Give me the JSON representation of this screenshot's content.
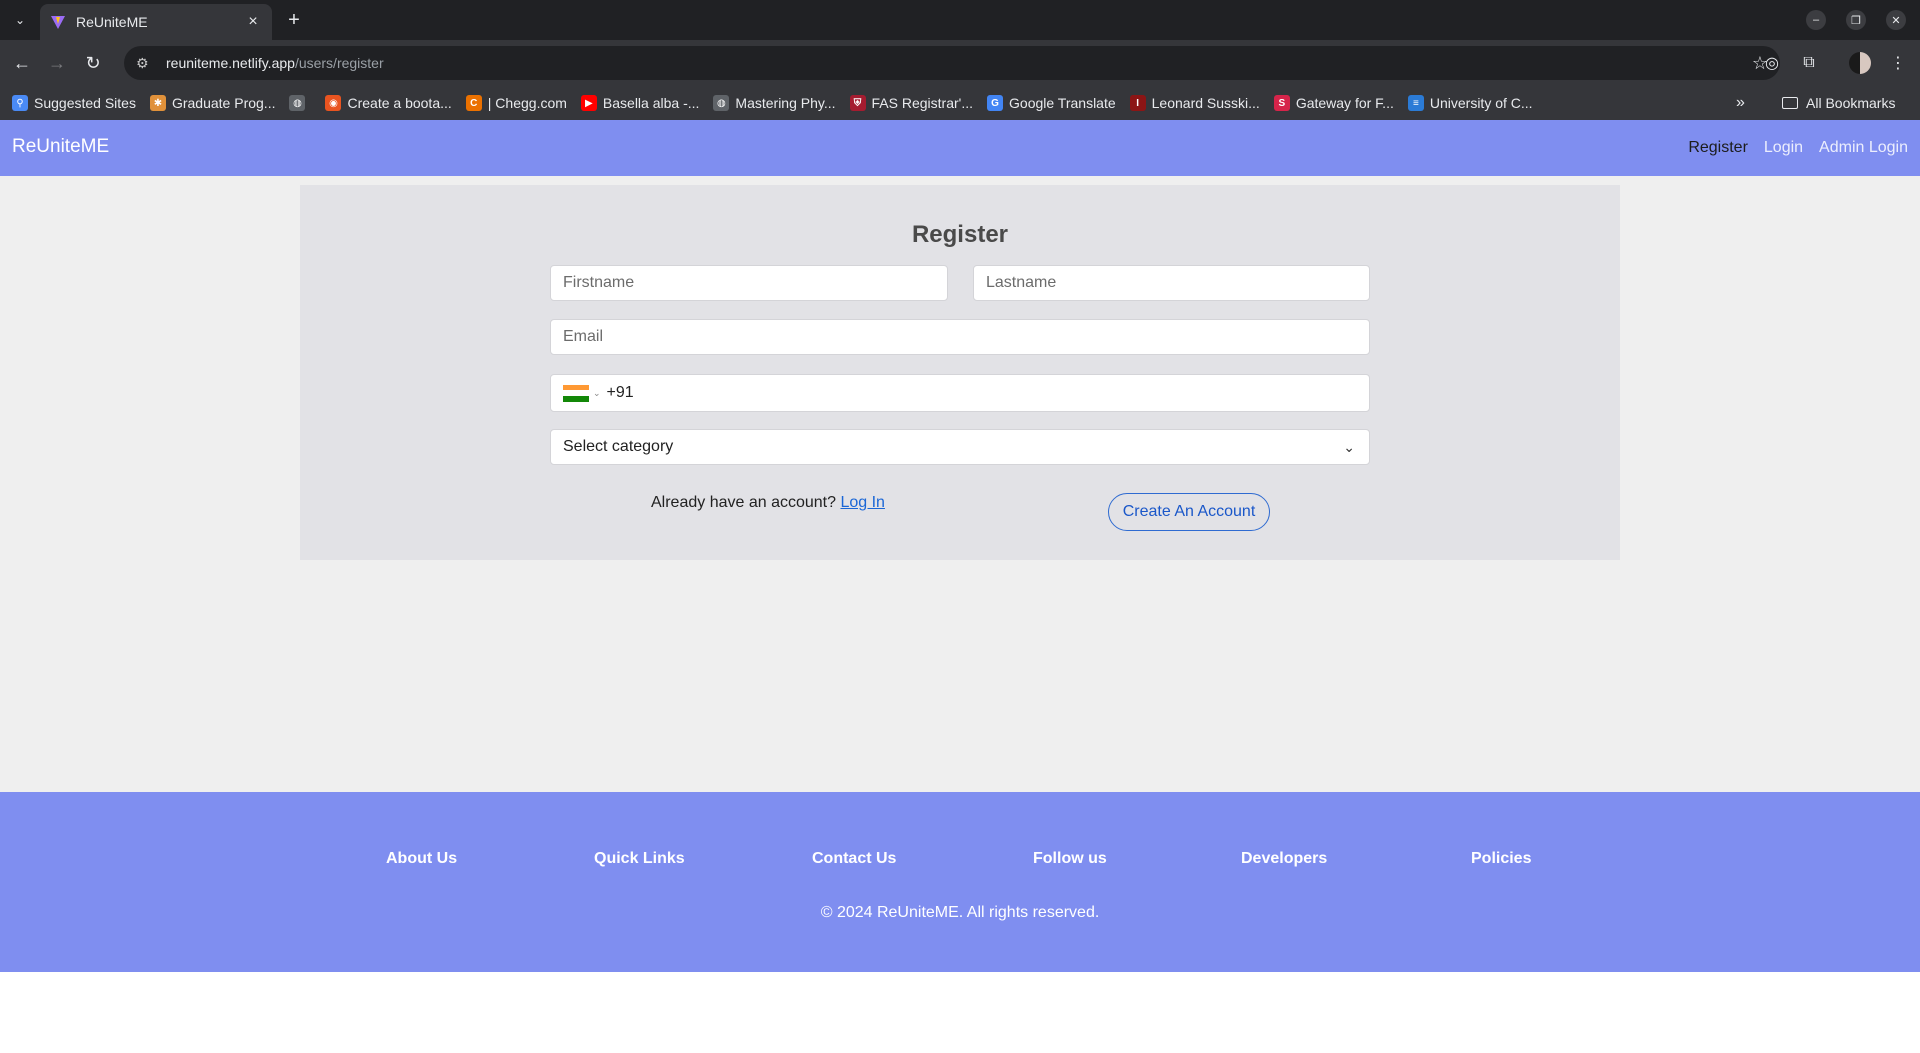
{
  "browser": {
    "tab_title": "ReUniteME",
    "url_host": "reuniteme.netlify.app",
    "url_path": "/users/register",
    "bookmarks": [
      {
        "label": "Suggested Sites",
        "icon": "search-icon",
        "color": "#4a8af4"
      },
      {
        "label": "Graduate Prog...",
        "icon": "gear-icon",
        "color": "#e0913a"
      },
      {
        "label": "",
        "icon": "globe-icon",
        "color": "#5f6368"
      },
      {
        "label": "Create a boota...",
        "icon": "ubuntu-icon",
        "color": "#e95420"
      },
      {
        "label": "| Chegg.com",
        "icon": "chegg-icon",
        "color": "#eb7100"
      },
      {
        "label": "Basella alba -...",
        "icon": "youtube-icon",
        "color": "#ff0000"
      },
      {
        "label": "Mastering Phy...",
        "icon": "globe-icon",
        "color": "#5f6368"
      },
      {
        "label": "FAS Registrar'...",
        "icon": "harvard-icon",
        "color": "#a51c30"
      },
      {
        "label": "Google Translate",
        "icon": "translate-icon",
        "color": "#4285f4"
      },
      {
        "label": "Leonard Susski...",
        "icon": "stanford-icon",
        "color": "#8c1515"
      },
      {
        "label": "Gateway for F...",
        "icon": "s-icon",
        "color": "#d6244a"
      },
      {
        "label": "University of C...",
        "icon": "uc-icon",
        "color": "#2b7bd6"
      }
    ],
    "all_bookmarks": "All Bookmarks"
  },
  "navbar": {
    "brand": "ReUniteME",
    "links": [
      "Register",
      "Login",
      "Admin Login"
    ]
  },
  "form": {
    "title": "Register",
    "firstname_placeholder": "Firstname",
    "lastname_placeholder": "Lastname",
    "email_placeholder": "Email",
    "phone_code": "+91",
    "category_value": "Select category",
    "already_text": "Already have an account?",
    "login_link": "Log In",
    "create_button": "Create An Account"
  },
  "footer": {
    "links": [
      "About Us",
      "Quick Links",
      "Contact Us",
      "Follow us",
      "Developers",
      "Policies"
    ],
    "copyright": "© 2024 ReUniteME. All rights reserved."
  },
  "colors": {
    "navbar_bg": "#7f8ef0",
    "card_bg": "#e2e2e6",
    "accent_link": "#1a66d6"
  }
}
